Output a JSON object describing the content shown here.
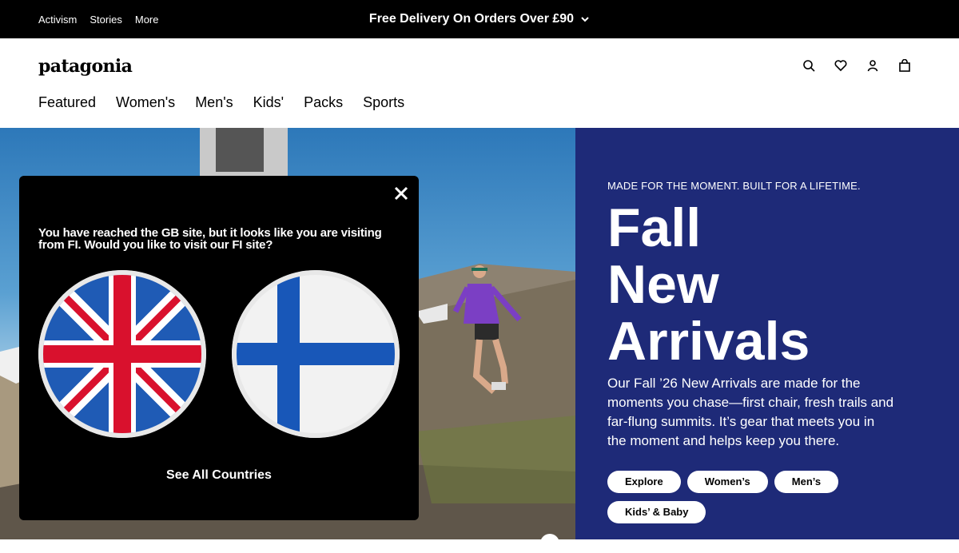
{
  "topbar": {
    "links": [
      "Activism",
      "Stories",
      "More"
    ],
    "promo": "Free Delivery On Orders Over £90"
  },
  "header": {
    "logo": "patagonia",
    "nav": [
      "Featured",
      "Women's",
      "Men's",
      "Kids'",
      "Packs",
      "Sports"
    ],
    "icons": [
      "search-icon",
      "heart-icon",
      "account-icon",
      "bag-icon"
    ]
  },
  "hero": {
    "eyebrow": "MADE FOR THE MOMENT. BUILT FOR A LIFETIME.",
    "headline": [
      "Fall",
      "New",
      "Arrivals"
    ],
    "body": "Our Fall ’26 New Arrivals are made for the moments you chase—first chair, fresh trails and far-flung summits. It’s gear that meets you in the moment and helps keep you there.",
    "buttons": [
      "Explore",
      "Women’s",
      "Men’s",
      "Kids’ & Baby"
    ],
    "panel_color": "#1e2a78"
  },
  "modal": {
    "message": "You have reached the GB site, but it looks like you are visiting from FI. Would you like to visit our FI site?",
    "flags": [
      "GB",
      "FI"
    ],
    "see_all": "See All Countries"
  }
}
